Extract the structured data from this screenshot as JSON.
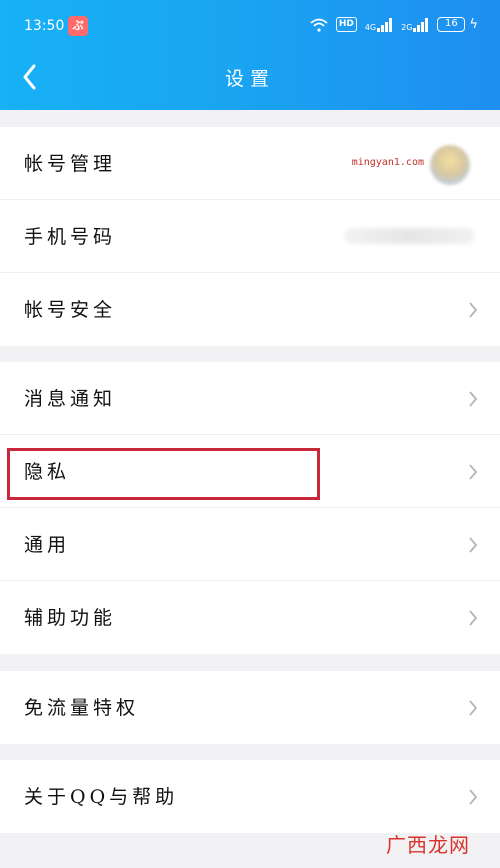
{
  "status_bar": {
    "time": "13:50",
    "app_badge": "ぷ",
    "hd": "HD",
    "net1": "4G",
    "net2": "2G",
    "battery": "16"
  },
  "header": {
    "title": "设置"
  },
  "groups": [
    {
      "items": [
        {
          "label": "帐号管理"
        },
        {
          "label": "手机号码"
        },
        {
          "label": "帐号安全"
        }
      ]
    },
    {
      "items": [
        {
          "label": "消息通知"
        },
        {
          "label": "隐私"
        },
        {
          "label": "通用"
        },
        {
          "label": "辅助功能"
        }
      ]
    },
    {
      "items": [
        {
          "label": "免流量特权"
        }
      ]
    },
    {
      "items": [
        {
          "label": "关于QQ与帮助"
        }
      ]
    }
  ],
  "watermark": "mingyan1.com",
  "footer_watermark": "广西龙网",
  "colors": {
    "header_start": "#17b1f7",
    "header_end": "#1e8ef0",
    "highlight": "#c9273a"
  }
}
